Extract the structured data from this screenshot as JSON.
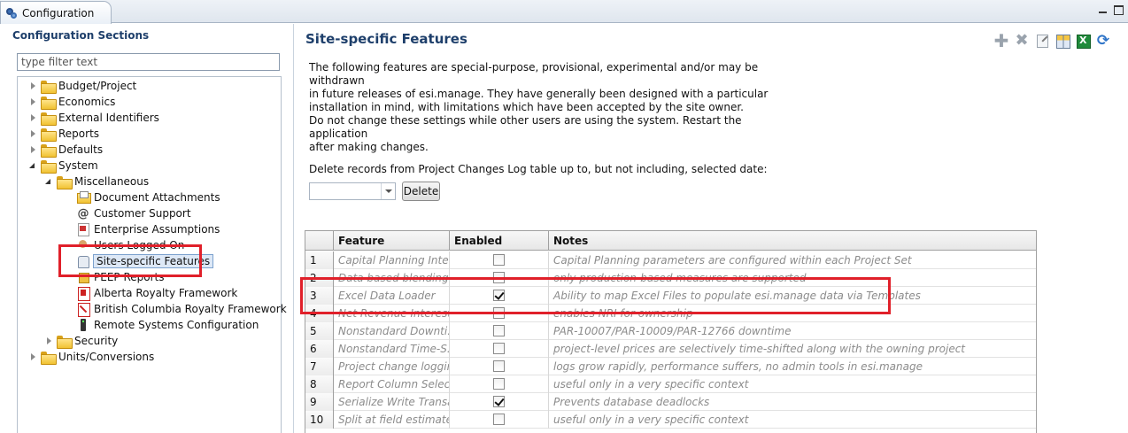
{
  "window": {
    "tab_title": "Configuration"
  },
  "left_panel": {
    "title": "Configuration Sections",
    "filter_placeholder": "type filter text",
    "tree": [
      {
        "label": "Budget/Project",
        "icon": "folder-icon",
        "expanded": false
      },
      {
        "label": "Economics",
        "icon": "folder-icon",
        "expanded": false
      },
      {
        "label": "External Identifiers",
        "icon": "folder-icon",
        "expanded": false
      },
      {
        "label": "Reports",
        "icon": "folder-icon",
        "expanded": false
      },
      {
        "label": "Defaults",
        "icon": "folder-icon",
        "expanded": false
      },
      {
        "label": "System",
        "icon": "folder-icon",
        "expanded": true
      },
      {
        "label": "Miscellaneous",
        "icon": "folder-icon",
        "expanded": true
      },
      {
        "label": "Document Attachments",
        "icon": "document-attachments-icon"
      },
      {
        "label": "Customer Support",
        "icon": "at-sign-icon"
      },
      {
        "label": "Enterprise Assumptions",
        "icon": "assumptions-icon"
      },
      {
        "label": "Users Logged On",
        "icon": "users-icon"
      },
      {
        "label": "Site-specific Features",
        "icon": "site-features-icon",
        "selected": true
      },
      {
        "label": "PEEP Reports",
        "icon": "peep-reports-icon"
      },
      {
        "label": "Alberta Royalty Framework",
        "icon": "alberta-royalty-icon"
      },
      {
        "label": "British Columbia Royalty Framework",
        "icon": "bc-royalty-icon"
      },
      {
        "label": "Remote Systems Configuration",
        "icon": "remote-systems-icon"
      },
      {
        "label": "Security",
        "icon": "folder-icon",
        "expanded": false
      },
      {
        "label": "Units/Conversions",
        "icon": "folder-icon",
        "expanded": false
      }
    ]
  },
  "main": {
    "title": "Site-specific Features",
    "toolbar_icons": [
      "add-icon",
      "remove-icon",
      "edit-icon",
      "grid-settings-icon",
      "excel-export-icon",
      "refresh-icon"
    ],
    "description_1": [
      "The following features are special-purpose, provisional, experimental and/or may be withdrawn",
      "in future releases of esi.manage.  They have generally been designed with a particular",
      "installation in mind, with limitations which have been accepted by the site owner."
    ],
    "description_2": [
      "Do not change these settings while other users are using the system.  Restart the application",
      "after making changes."
    ],
    "delete_prompt": "Delete records from Project Changes Log table up to, but not including, selected date:",
    "date_value": "",
    "delete_label": "Delete",
    "table": {
      "columns": [
        "",
        "Feature",
        "Enabled",
        "Notes"
      ],
      "rows": [
        {
          "num": "1",
          "feature": "Capital Planning Inte...",
          "enabled": false,
          "notes": "Capital Planning parameters are configured within each Project Set"
        },
        {
          "num": "2",
          "feature": "Data based blending",
          "enabled": false,
          "notes": "only production-based measures are supported"
        },
        {
          "num": "3",
          "feature": "Excel Data Loader",
          "enabled": true,
          "notes": "Ability to map Excel Files to populate esi.manage data via Templates"
        },
        {
          "num": "4",
          "feature": "Net Revenue Interest",
          "enabled": false,
          "notes": "enables NRI for ownership"
        },
        {
          "num": "5",
          "feature": "Nonstandard Downti...",
          "enabled": false,
          "notes": "PAR-10007/PAR-10009/PAR-12766 downtime"
        },
        {
          "num": "6",
          "feature": "Nonstandard Time-S...",
          "enabled": false,
          "notes": "project-level prices are selectively time-shifted along with the owning project"
        },
        {
          "num": "7",
          "feature": "Project change logging",
          "enabled": false,
          "notes": "logs grow rapidly, performance suffers, no admin tools in esi.manage"
        },
        {
          "num": "8",
          "feature": "Report Column Selecti...",
          "enabled": false,
          "notes": "useful only in a very specific context"
        },
        {
          "num": "9",
          "feature": "Serialize Write Transa...",
          "enabled": true,
          "notes": "Prevents database deadlocks"
        },
        {
          "num": "10",
          "feature": "Split at field estimate",
          "enabled": false,
          "notes": "useful only in a very specific context"
        }
      ]
    }
  },
  "colors": {
    "highlight": "#e0202a",
    "title": "#1e3f6b",
    "selection": "#dde8f6"
  }
}
